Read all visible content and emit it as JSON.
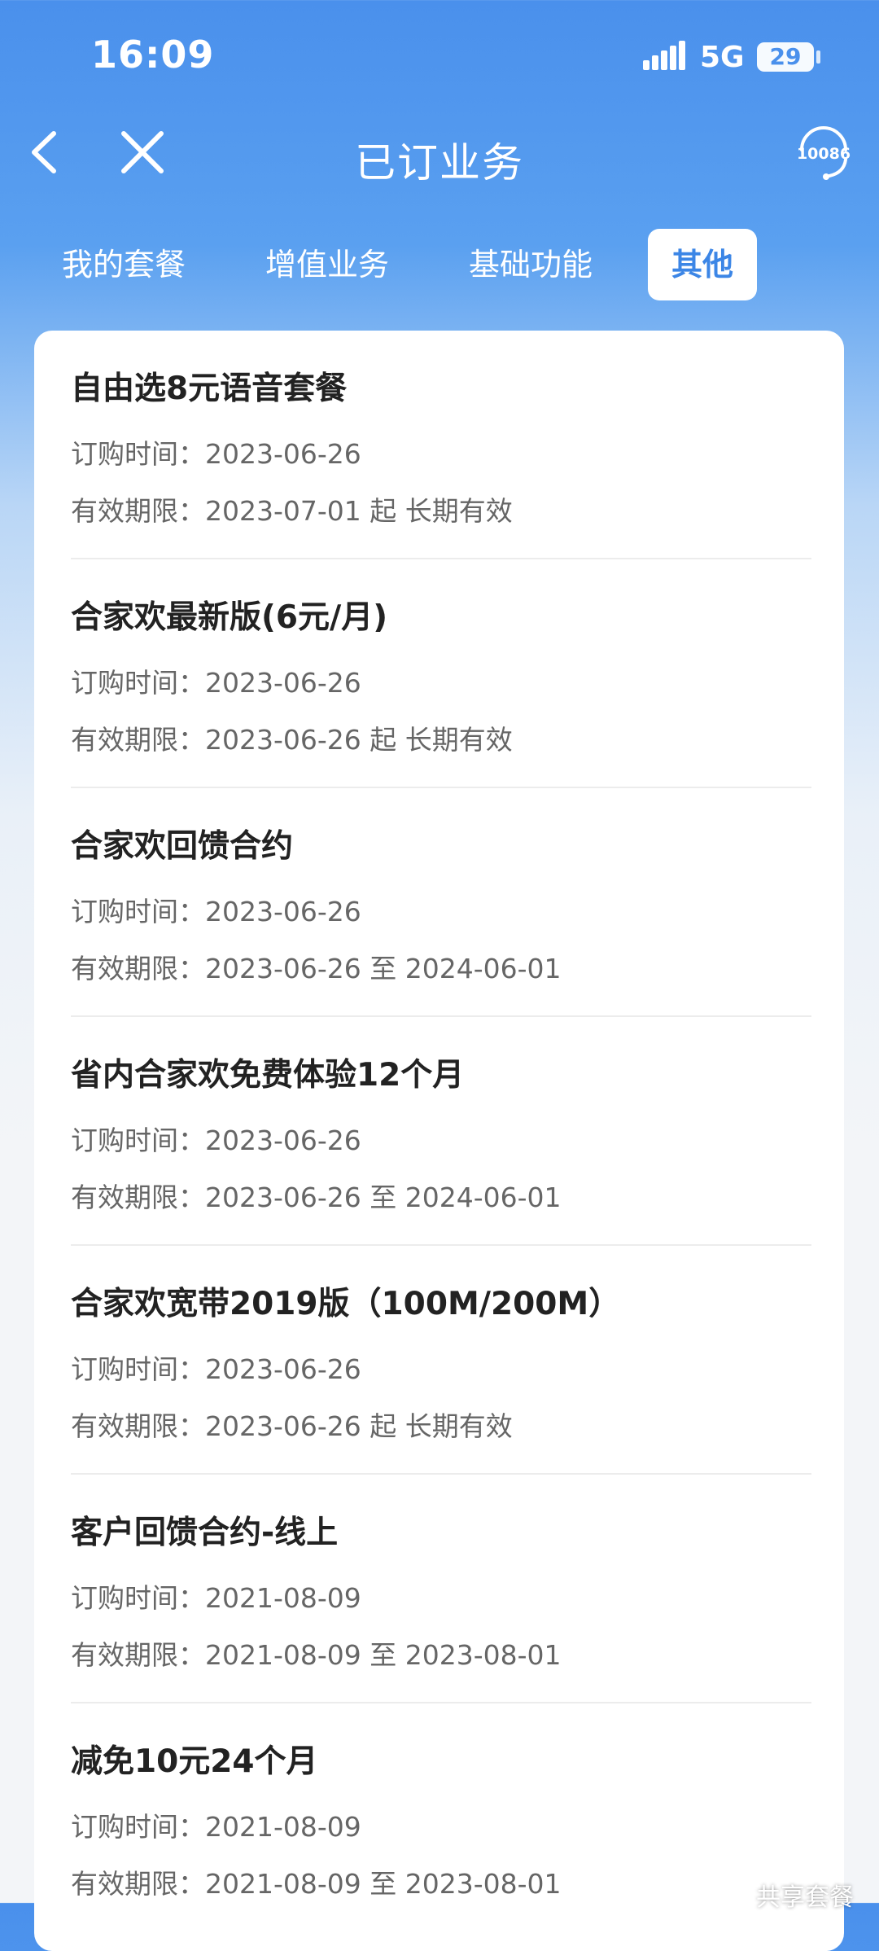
{
  "status_bar": {
    "time": "16:09",
    "network": "5G",
    "battery": "29",
    "signal_icon": "signal-icon"
  },
  "nav": {
    "title": "已订业务",
    "service_number": "10086",
    "back_icon": "back-icon",
    "close_icon": "close-icon"
  },
  "tabs": [
    {
      "label": "我的套餐",
      "active": false
    },
    {
      "label": "增值业务",
      "active": false
    },
    {
      "label": "基础功能",
      "active": false
    },
    {
      "label": "其他",
      "active": true
    }
  ],
  "items": [
    {
      "title": "自由选8元语音套餐",
      "order_label": "订购时间：",
      "order_date": "2023-06-26",
      "valid_label": "有效期限：",
      "valid_range": "2023-07-01 起 长期有效"
    },
    {
      "title": "合家欢最新版(6元/月)",
      "order_label": "订购时间：",
      "order_date": "2023-06-26",
      "valid_label": "有效期限：",
      "valid_range": "2023-06-26 起 长期有效"
    },
    {
      "title": "合家欢回馈合约",
      "order_label": "订购时间：",
      "order_date": "2023-06-26",
      "valid_label": "有效期限：",
      "valid_range": "2023-06-26 至 2024-06-01"
    },
    {
      "title": "省内合家欢免费体验12个月",
      "order_label": "订购时间：",
      "order_date": "2023-06-26",
      "valid_label": "有效期限：",
      "valid_range": "2023-06-26 至 2024-06-01"
    },
    {
      "title": "合家欢宽带2019版（100M/200M）",
      "order_label": "订购时间：",
      "order_date": "2023-06-26",
      "valid_label": "有效期限：",
      "valid_range": "2023-06-26 起 长期有效"
    },
    {
      "title": "客户回馈合约-线上",
      "order_label": "订购时间：",
      "order_date": "2021-08-09",
      "valid_label": "有效期限：",
      "valid_range": "2021-08-09 至 2023-08-01"
    },
    {
      "title": "减免10元24个月",
      "order_label": "订购时间：",
      "order_date": "2021-08-09",
      "valid_label": "有效期限：",
      "valid_range": "2021-08-09 至 2023-08-01"
    }
  ],
  "watermark": {
    "text": "共享套餐",
    "icon": "wechat-icon"
  },
  "colors": {
    "header_blue": "#4a90ec",
    "active_tab_text": "#3c86e6"
  }
}
